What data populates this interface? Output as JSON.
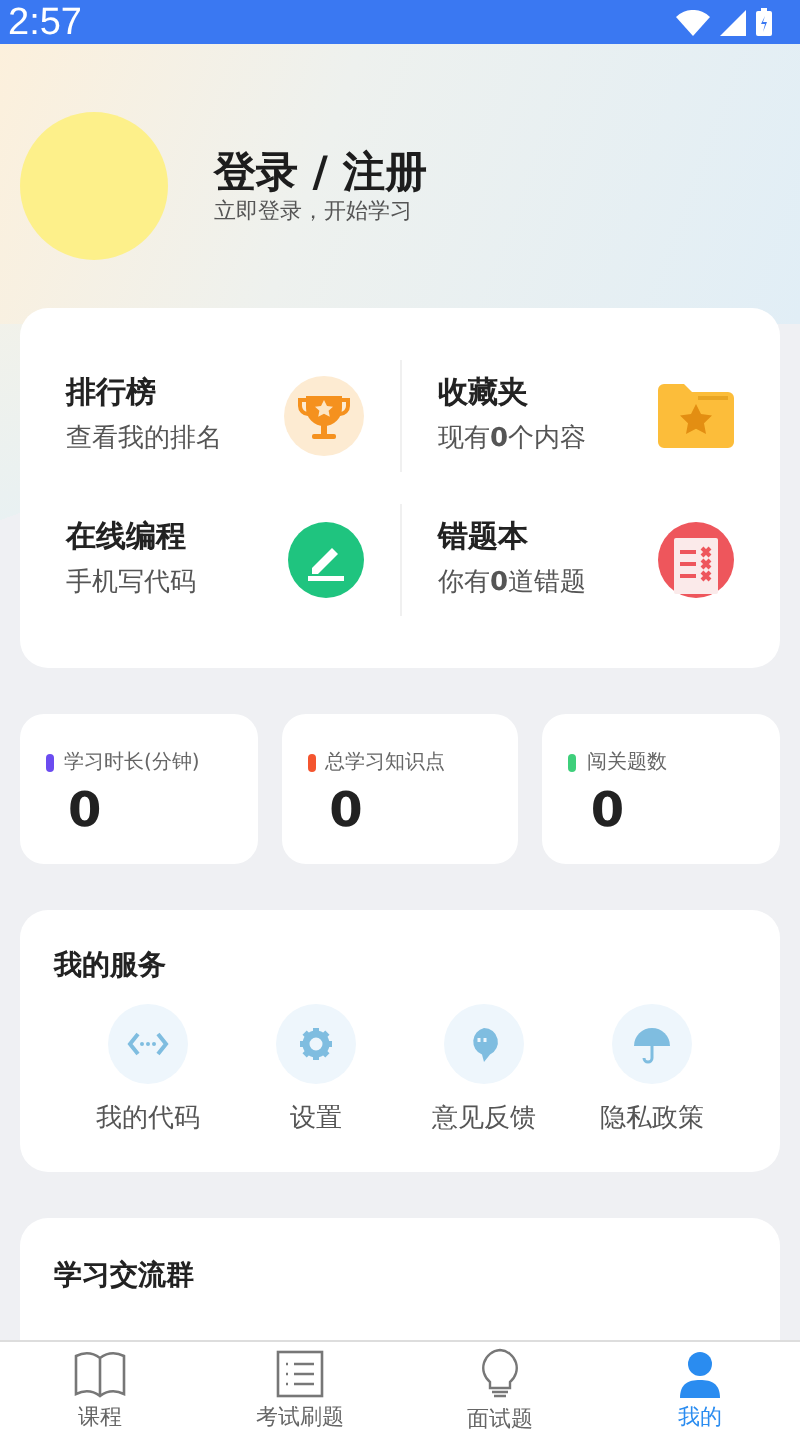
{
  "status_bar": {
    "time": "2:57"
  },
  "profile": {
    "title": "登录 / 注册",
    "subtitle": "立即登录，开始学习"
  },
  "features": [
    {
      "title": "排行榜",
      "subtitle": "查看我的排名",
      "kind": "trophy"
    },
    {
      "title": "收藏夹",
      "subtitle": "现有**0**个内容",
      "kind": "folder"
    },
    {
      "title": "在线编程",
      "subtitle": "手机写代码",
      "kind": "pencil"
    },
    {
      "title": "错题本",
      "subtitle": "你有**0**道错题",
      "kind": "notebook"
    }
  ],
  "stats": [
    {
      "label": "学习时长(分钟)",
      "value": "0",
      "color": "#6b4cf0"
    },
    {
      "label": "总学习知识点",
      "value": "0",
      "color": "#f4552f"
    },
    {
      "label": "闯关题数",
      "value": "0",
      "color": "#3ecf7b"
    }
  ],
  "services": {
    "title": "我的服务",
    "items": [
      {
        "label": "我的代码",
        "kind": "code"
      },
      {
        "label": "设置",
        "kind": "gear"
      },
      {
        "label": "意见反馈",
        "kind": "feedback"
      },
      {
        "label": "隐私政策",
        "kind": "umbrella"
      }
    ]
  },
  "group": {
    "title": "学习交流群"
  },
  "tabs": [
    {
      "label": "课程",
      "kind": "book",
      "selected": false
    },
    {
      "label": "考试刷题",
      "kind": "list",
      "selected": false
    },
    {
      "label": "面试题",
      "kind": "bulb",
      "selected": false
    },
    {
      "label": "我的",
      "kind": "person",
      "selected": true
    }
  ]
}
